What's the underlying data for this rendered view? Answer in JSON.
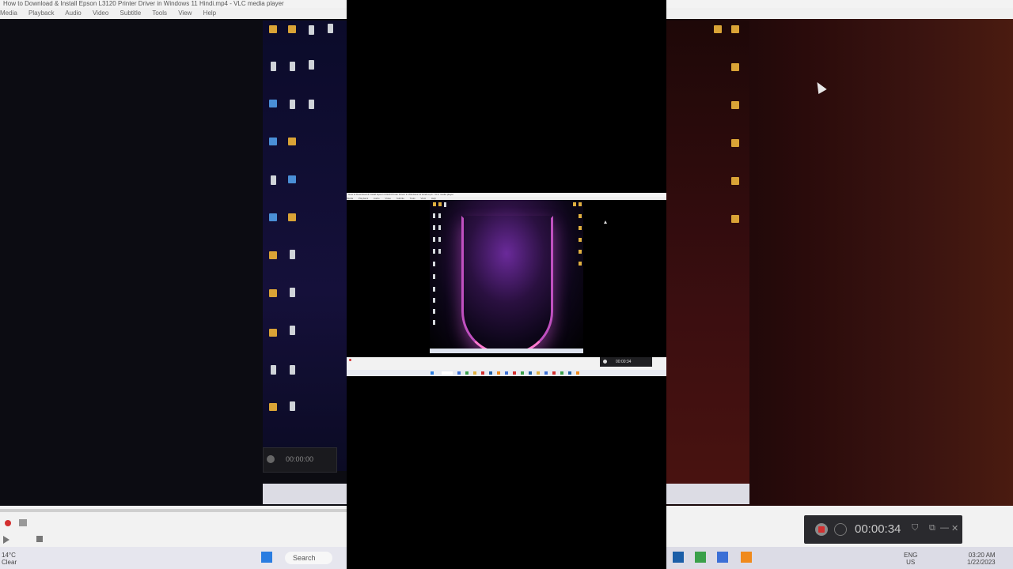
{
  "window": {
    "title": "How to Download & Install Epson L3120 Printer Driver in Windows 11 Hindi.mp4 - VLC media player"
  },
  "menu": {
    "items": [
      "Media",
      "Playback",
      "Audio",
      "Video",
      "Subtitle",
      "Tools",
      "View",
      "Help"
    ]
  },
  "left_recorder": {
    "time": "00:00:00"
  },
  "recorder": {
    "time": "00:00:34"
  },
  "mini_recorder": {
    "time": "00:00:34"
  },
  "taskbar": {
    "weather_temp": "14°C",
    "weather_desc": "Clear",
    "search_label": "Search",
    "lang": "ENG",
    "region": "US",
    "time": "03:20 AM",
    "date": "1/22/2023"
  },
  "colors": {
    "record_red": "#d32f2f",
    "wallpaper_glow": "#ff7ad0",
    "folder_yellow": "#e0b040"
  }
}
